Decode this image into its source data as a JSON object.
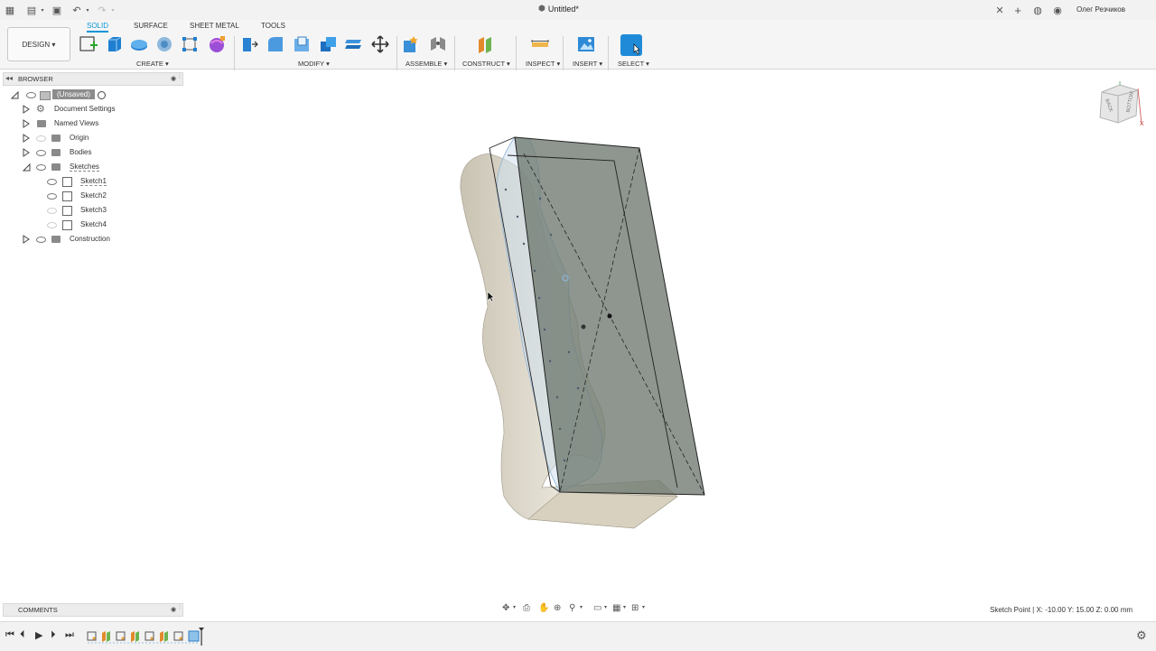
{
  "titlebar": {
    "doc_title": "Untitled*",
    "user": "Олег Резчиков"
  },
  "ribbon": {
    "tabs": [
      "SOLID",
      "SURFACE",
      "SHEET METAL",
      "TOOLS"
    ],
    "active_tab": "SOLID",
    "workspace_button": "DESIGN ▾",
    "groups": {
      "create": "CREATE ▾",
      "modify": "MODIFY ▾",
      "assemble": "ASSEMBLE ▾",
      "construct": "CONSTRUCT ▾",
      "inspect": "INSPECT ▾",
      "insert": "INSERT ▾",
      "select": "SELECT ▾"
    }
  },
  "browser": {
    "title": "BROWSER",
    "root": "(Unsaved)",
    "items": [
      {
        "label": "Document Settings"
      },
      {
        "label": "Named Views"
      },
      {
        "label": "Origin"
      },
      {
        "label": "Bodies"
      },
      {
        "label": "Sketches"
      },
      {
        "label": "Sketch1"
      },
      {
        "label": "Sketch2"
      },
      {
        "label": "Sketch3"
      },
      {
        "label": "Sketch4"
      },
      {
        "label": "Construction"
      }
    ]
  },
  "viewcube": {
    "faces": [
      "BACK",
      "BOTTOM"
    ],
    "axis": "X"
  },
  "comments": {
    "title": "COMMENTS"
  },
  "status": {
    "text": "Sketch Point | X: -10.00 Y: 15.00 Z: 0.00 mm"
  },
  "colors": {
    "accent": "#0696d7",
    "sketch_blue": "#8fb4d8",
    "body": "#d6d0c0",
    "plane": "#6e7870"
  }
}
